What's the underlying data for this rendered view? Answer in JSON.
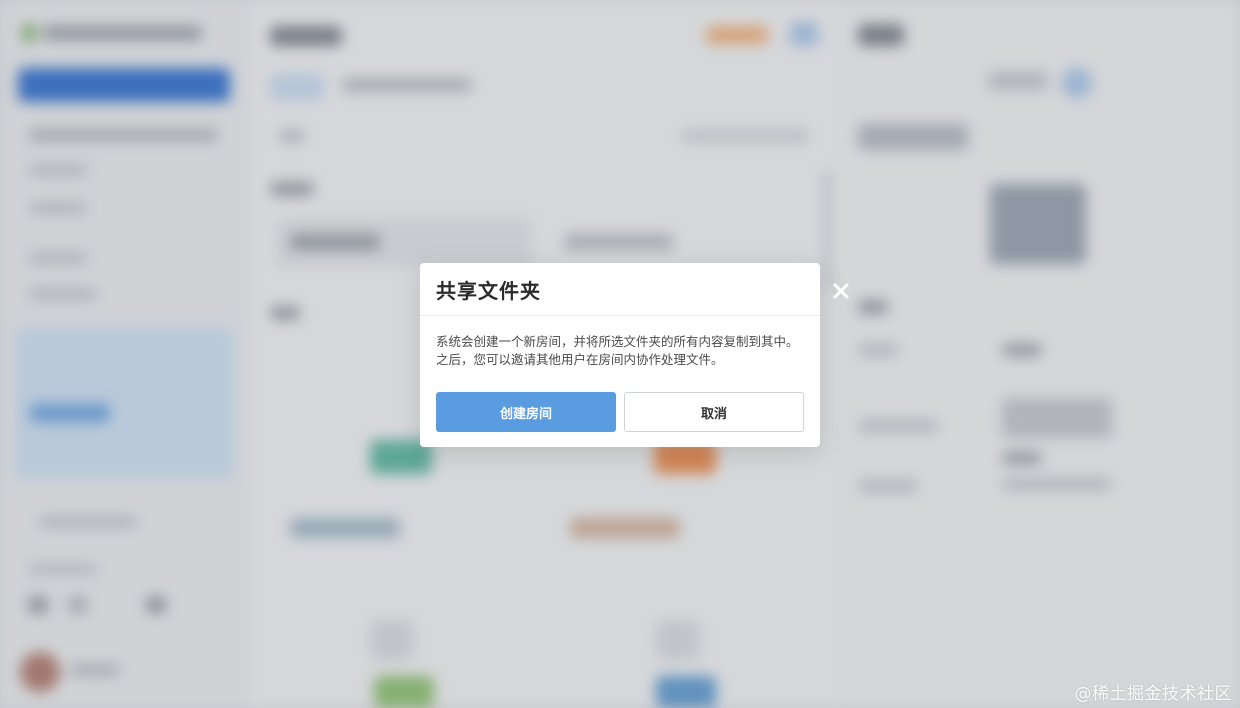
{
  "dialog": {
    "title": "共享文件夹",
    "message": "系统会创建一个新房间，并将所选文件夹的所有内容复制到其中。之后，您可以邀请其他用户在房间内协作处理文件。",
    "confirm_label": "创建房间",
    "cancel_label": "取消",
    "close_icon": "close-icon"
  },
  "watermark": "@稀土掘金技术社区",
  "colors": {
    "primary": "#5a9ce0",
    "overlay": "#6e747c",
    "sidebar_active": "#2f6fd0"
  }
}
